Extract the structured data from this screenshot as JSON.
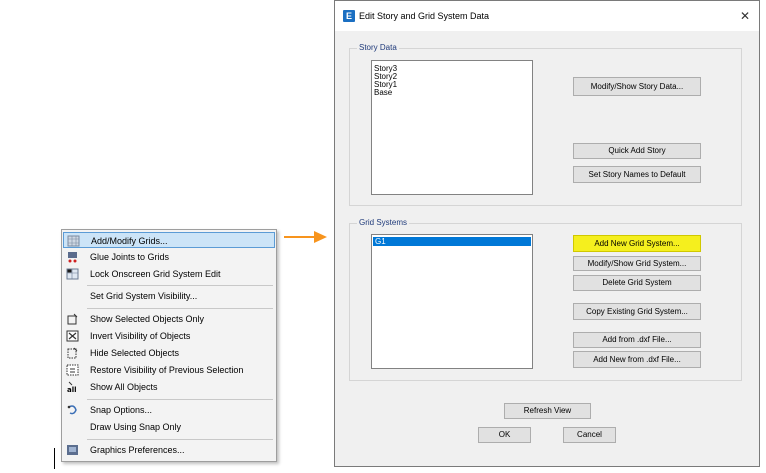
{
  "menu": {
    "items": [
      {
        "label": "Add/Modify Grids...",
        "icon": "grid-icon"
      },
      {
        "label": "Glue Joints to Grids",
        "icon": "glue-joints-icon"
      },
      {
        "label": "Lock Onscreen Grid System Edit",
        "icon": "lock-grid-icon"
      },
      {
        "label": "Set Grid System Visibility..."
      },
      {
        "label": "Show Selected Objects Only",
        "icon": "show-selected-icon"
      },
      {
        "label": "Invert Visibility of Objects",
        "icon": "invert-visibility-icon"
      },
      {
        "label": "Hide Selected Objects",
        "icon": "hide-selected-icon"
      },
      {
        "label": "Restore Visibility of Previous Selection",
        "icon": "restore-visibility-icon"
      },
      {
        "label": "Show All Objects",
        "icon": "show-all-icon"
      },
      {
        "label": "Snap Options...",
        "icon": "snap-icon"
      },
      {
        "label": "Draw Using Snap Only"
      },
      {
        "label": "Graphics Preferences...",
        "icon": "graphics-preferences-icon"
      }
    ]
  },
  "dialog": {
    "title": "Edit Story and Grid System Data",
    "app_icon": "E",
    "close": "✕",
    "story_data": {
      "label": "Story Data",
      "stories": [
        "Story3",
        "Story2",
        "Story1",
        "Base"
      ],
      "modify_button": "Modify/Show Story Data...",
      "quick_add_button": "Quick Add Story",
      "default_names_button": "Set Story Names to Default"
    },
    "grid_systems": {
      "label": "Grid Systems",
      "systems": [
        "G1"
      ],
      "add_new_button": "Add New Grid System...",
      "modify_button": "Modify/Show Grid System...",
      "delete_button": "Delete Grid System",
      "copy_button": "Copy Existing Grid System...",
      "add_dxf_button": "Add from .dxf File...",
      "add_new_dxf_button": "Add New from .dxf File..."
    },
    "refresh_button": "Refresh View",
    "ok_button": "OK",
    "cancel_button": "Cancel"
  },
  "colors": {
    "highlight": "#f5ef1e",
    "arrow": "#f7941d",
    "selection": "#0078d7"
  }
}
